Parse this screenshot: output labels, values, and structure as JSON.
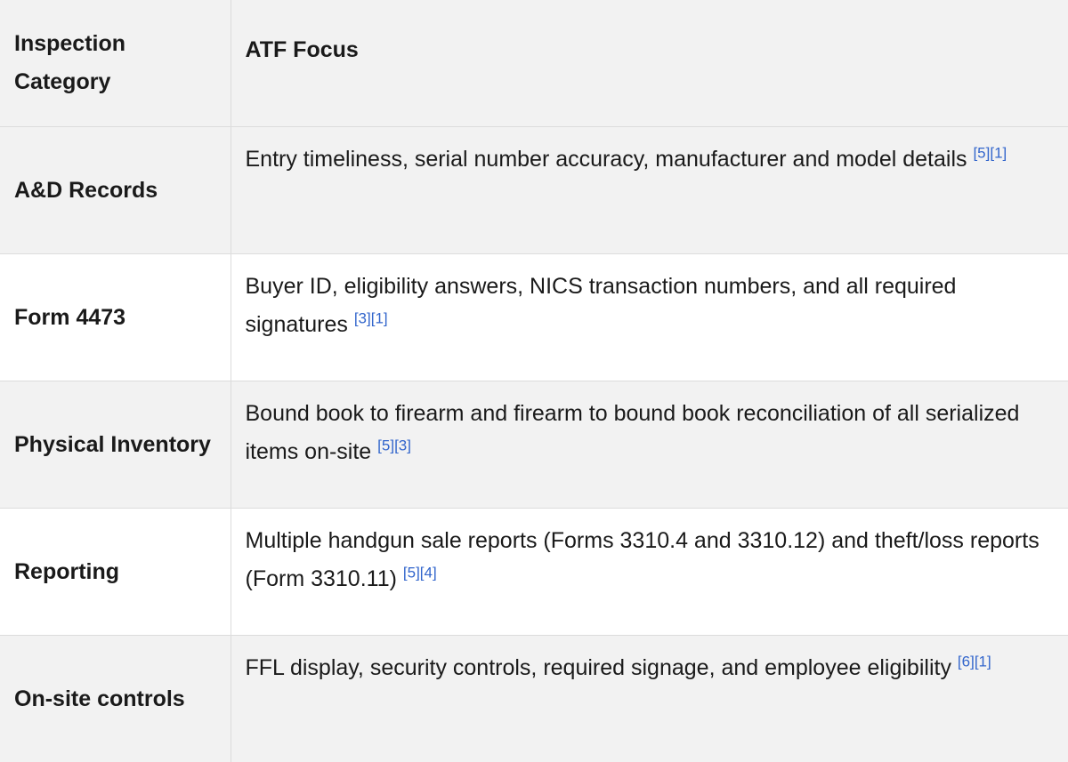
{
  "table": {
    "header": {
      "category": "Inspection Category",
      "focus": "ATF Focus"
    },
    "rows": [
      {
        "category": "A&D Records",
        "focus": "Entry timeliness, serial number accuracy, manufacturer and model details",
        "citations": [
          "[5]",
          "[1]"
        ]
      },
      {
        "category": "Form 4473",
        "focus": "Buyer ID, eligibility answers, NICS transaction numbers, and all required signatures",
        "citations": [
          "[3]",
          "[1]"
        ]
      },
      {
        "category": "Physical Inventory",
        "focus": "Bound book to firearm and firearm to bound book reconciliation of all serialized items on-site",
        "citations": [
          "[5]",
          "[3]"
        ]
      },
      {
        "category": "Reporting",
        "focus": "Multiple handgun sale reports (Forms 3310.4 and 3310.12) and theft/loss reports (Form 3310.11)",
        "citations": [
          "[5]",
          "[4]"
        ]
      },
      {
        "category": "On-site controls",
        "focus": "FFL display, security controls, required signage, and employee eligibility",
        "citations": [
          "[6]",
          "[1]"
        ]
      }
    ]
  },
  "colors": {
    "header_bg": "#f2f2f2",
    "alt_row_bg": "#ffffff",
    "citation_link": "#3366cc",
    "border": "#dcdcdc"
  }
}
